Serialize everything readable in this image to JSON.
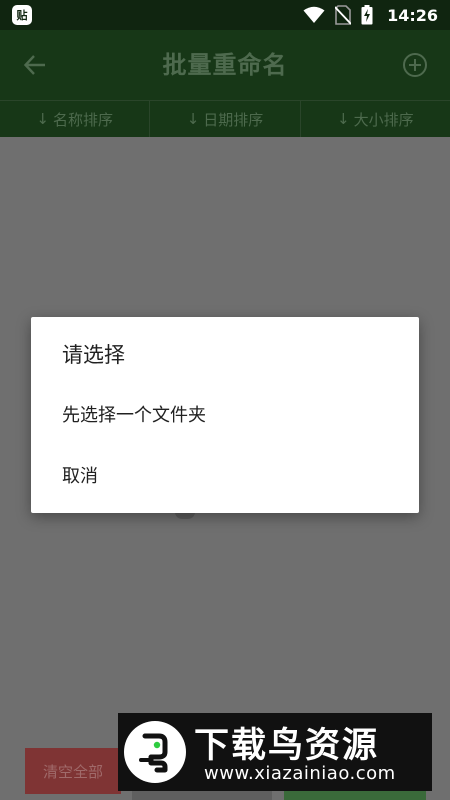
{
  "status_bar": {
    "app_icon_text": "贴",
    "time": "14:26",
    "icons": [
      "wifi-icon",
      "no-sim-icon",
      "battery-charging-icon"
    ]
  },
  "app_bar": {
    "title": "批量重命名",
    "back_icon": "arrow-left-icon",
    "add_icon": "plus-circle-icon"
  },
  "sort_bar": {
    "tabs": [
      {
        "arrow": "↓",
        "label": "名称排序"
      },
      {
        "arrow": "↓",
        "label": "日期排序"
      },
      {
        "arrow": "↓",
        "label": "大小排序"
      }
    ]
  },
  "dialog": {
    "title": "请选择",
    "options": [
      "先选择一个文件夹",
      "取消"
    ]
  },
  "bottom_buttons": {
    "clear_label": "清空全部"
  },
  "watermark": {
    "name": "下载鸟资源",
    "url": "www.xiazainiao.com"
  },
  "colors": {
    "status_bar": "#102510",
    "app_bar": "#173717",
    "dim_background": "#6f6f6f",
    "dialog_bg": "#ffffff",
    "clear_button": "#7f3434"
  }
}
